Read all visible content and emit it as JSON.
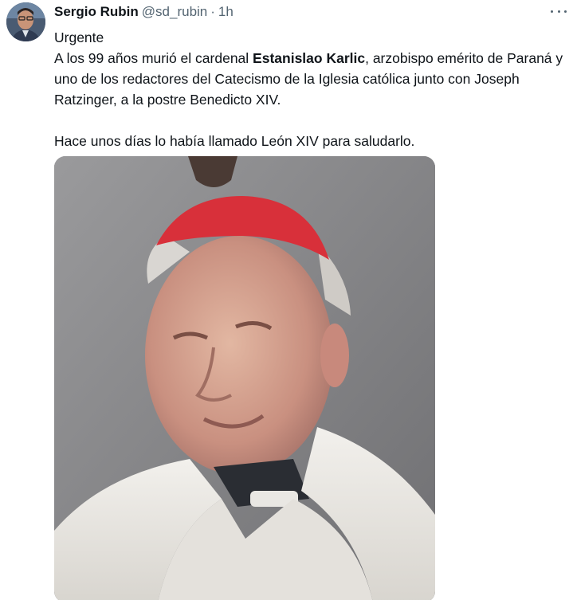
{
  "author": {
    "name": "Sergio Rubin",
    "handle": "@sd_rubin",
    "separator": "·",
    "time": "1h"
  },
  "tweet": {
    "line1": "Urgente",
    "line2_before": "A los 99 años murió el cardenal ",
    "line2_bold": "Estanislao Karlic",
    "line2_after": ", arzobispo emérito de Paraná y uno de los redactores del Catecismo de la Iglesia católica junto con Joseph Ratzinger, a la postre Benedicto XIV.",
    "line3": "Hace unos días lo había llamado León XIV para saludarlo."
  },
  "icons": {
    "more": "more-options-icon"
  }
}
